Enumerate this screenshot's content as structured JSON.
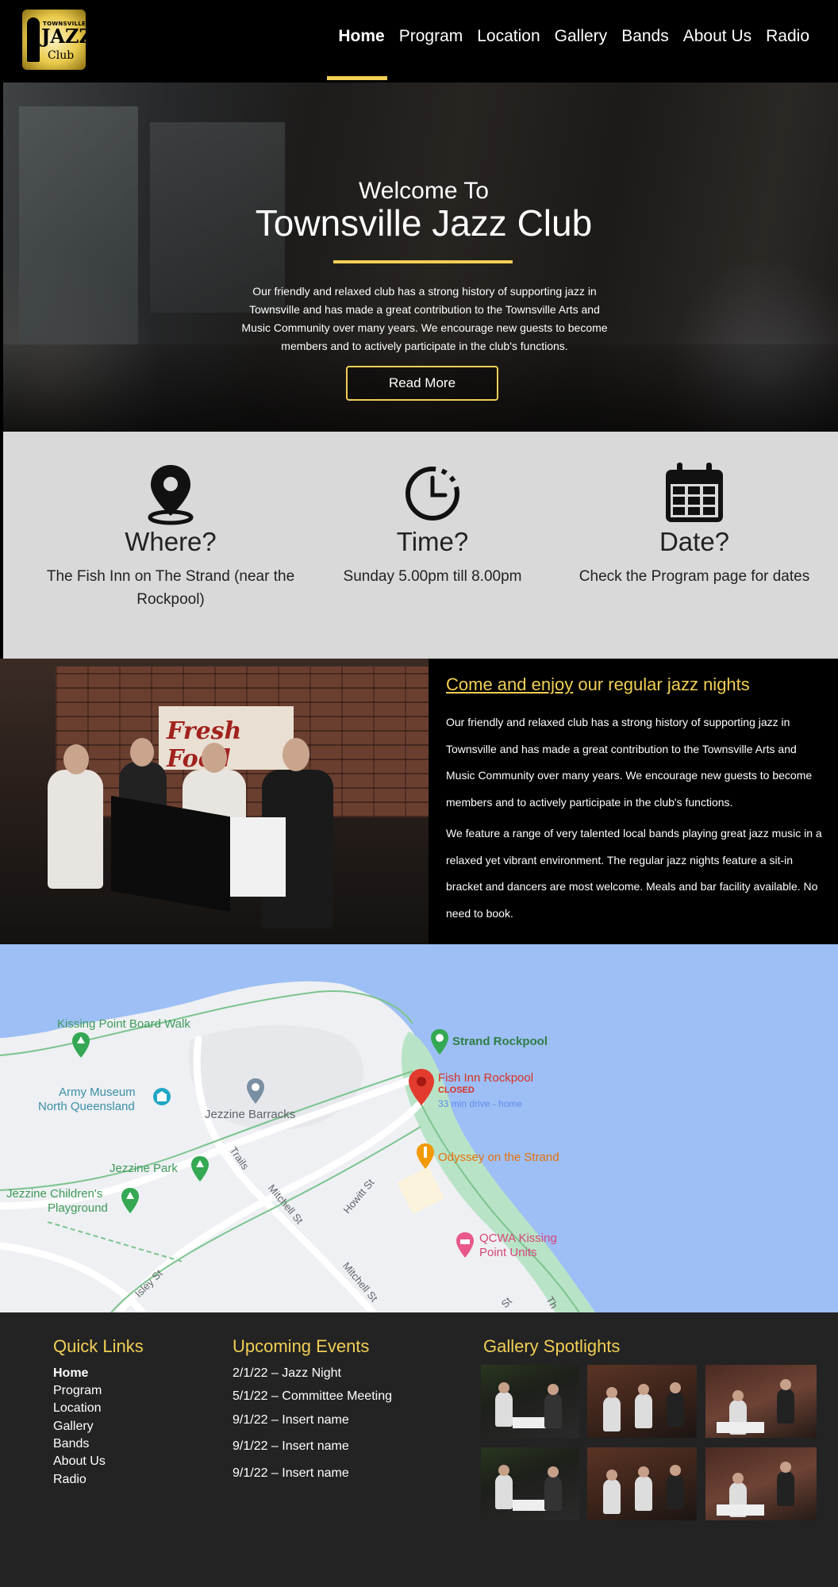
{
  "header": {
    "logo": {
      "line1": "TOWNSVILLE",
      "line2": "JAZZ",
      "line3": "Club"
    },
    "nav": [
      "Home",
      "Program",
      "Location",
      "Gallery",
      "Bands",
      "About Us",
      "Radio"
    ],
    "active": "Home"
  },
  "hero": {
    "subtitle": "Welcome To",
    "title": "Townsville Jazz Club",
    "text": "Our friendly and relaxed club has a strong history of supporting jazz in Townsville and has made a great contribution to the Townsville Arts and Music Community over many years.  We encourage new guests to become members and to actively participate in the club's functions.",
    "button": "Read More"
  },
  "info": [
    {
      "icon": "map-pin-icon",
      "title": "Where?",
      "text": "The Fish Inn on The Strand (near the Rockpool)"
    },
    {
      "icon": "clock-icon",
      "title": "Time?",
      "text": "Sunday 5.00pm till 8.00pm"
    },
    {
      "icon": "calendar-icon",
      "title": "Date?",
      "text": "Check the Program page for dates"
    }
  ],
  "feature": {
    "title_link": "Come and enjoy",
    "title_rest": " our regular jazz nights",
    "p1": "Our friendly and relaxed club has a strong history of supporting jazz in Townsville and has made a great contribution to the Townsville Arts and Music Community over many years.  We encourage new guests to become members and to actively participate in the club's functions.",
    "p2": "We feature a range of very talented local bands playing great jazz music in a relaxed yet vibrant environment. The regular jazz nights feature a sit-in bracket and dancers are most welcome. Meals and bar facility available. No need to book.",
    "photo_sign": "Fresh Food"
  },
  "map": {
    "places": [
      {
        "name": "Kissing Point Board Walk",
        "color": "#3e9a5a"
      },
      {
        "name": "Strand Rockpool",
        "color": "#3e9a5a"
      },
      {
        "name": "Fish Inn Rockpool",
        "color": "#d93025"
      },
      {
        "name": "CLOSED",
        "color": "#d93025"
      },
      {
        "name": "33 min drive - home",
        "color": "#5b8de8"
      },
      {
        "name": "Army Museum",
        "color": "#3a8fa8"
      },
      {
        "name": "North Queensland",
        "color": "#3a8fa8"
      },
      {
        "name": "Jezzine Barracks",
        "color": "#5f6368"
      },
      {
        "name": "Odyssey on the Strand",
        "color": "#e8710a"
      },
      {
        "name": "Jezzine Park",
        "color": "#3e9a5a"
      },
      {
        "name": "Jezzine Children's",
        "color": "#3e9a5a"
      },
      {
        "name": "Playground",
        "color": "#3e9a5a"
      },
      {
        "name": "QCWA Kissing",
        "color": "#d6457a"
      },
      {
        "name": "Point Units",
        "color": "#d6457a"
      }
    ],
    "streets": [
      "Trails",
      "Mitchell St",
      "Howitt St",
      "Mitchell St",
      "Isley St",
      "St",
      "Th"
    ]
  },
  "footer": {
    "quick_links_title": "Quick Links",
    "quick_links": [
      "Home",
      "Program",
      "Location",
      "Gallery",
      "Bands",
      "About Us",
      "Radio"
    ],
    "events_title": "Upcoming Events",
    "events": [
      "2/1/22 – Jazz Night",
      "5/1/22 – Committee Meeting",
      "9/1/22 – Insert name",
      "9/1/22 – Insert name",
      "9/1/22 – Insert name"
    ],
    "gallery_title": "Gallery Spotlights"
  },
  "colors": {
    "accent": "#f2cf55",
    "info_bg": "#d9d9d9",
    "footer_bg": "#232323",
    "water": "#9dbff5",
    "park": "#b9e3c7"
  }
}
